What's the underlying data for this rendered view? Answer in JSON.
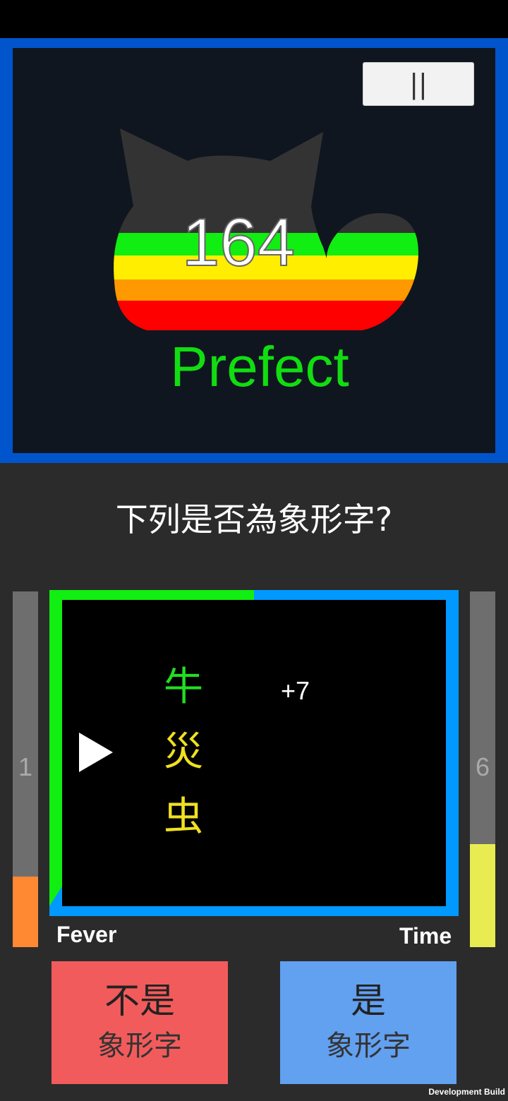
{
  "header": {
    "pause_label": "||",
    "score": "164",
    "rating": "Prefect"
  },
  "question": "下列是否為象形字?",
  "fever": {
    "value": "1",
    "label": "Fever",
    "fill_color": "#ff8833"
  },
  "time": {
    "value": "6",
    "label": "Time",
    "fill_color": "#e8ec50"
  },
  "board": {
    "characters": [
      {
        "text": "牛",
        "color": "#22dd22"
      },
      {
        "text": "災",
        "color": "#f0e020"
      },
      {
        "text": "虫",
        "color": "#f0e020"
      }
    ],
    "bonus": "+7",
    "frame_colors": {
      "green": "#11ee11",
      "blue": "#0099ff"
    }
  },
  "buttons": {
    "no": {
      "main": "不是",
      "sub": "象形字",
      "color": "#f25b5b"
    },
    "yes": {
      "main": "是",
      "sub": "象形字",
      "color": "#62a0f0"
    }
  },
  "footer": "Development Build",
  "icons": [
    "pause-icon",
    "cat-icon",
    "play-pointer-icon"
  ]
}
